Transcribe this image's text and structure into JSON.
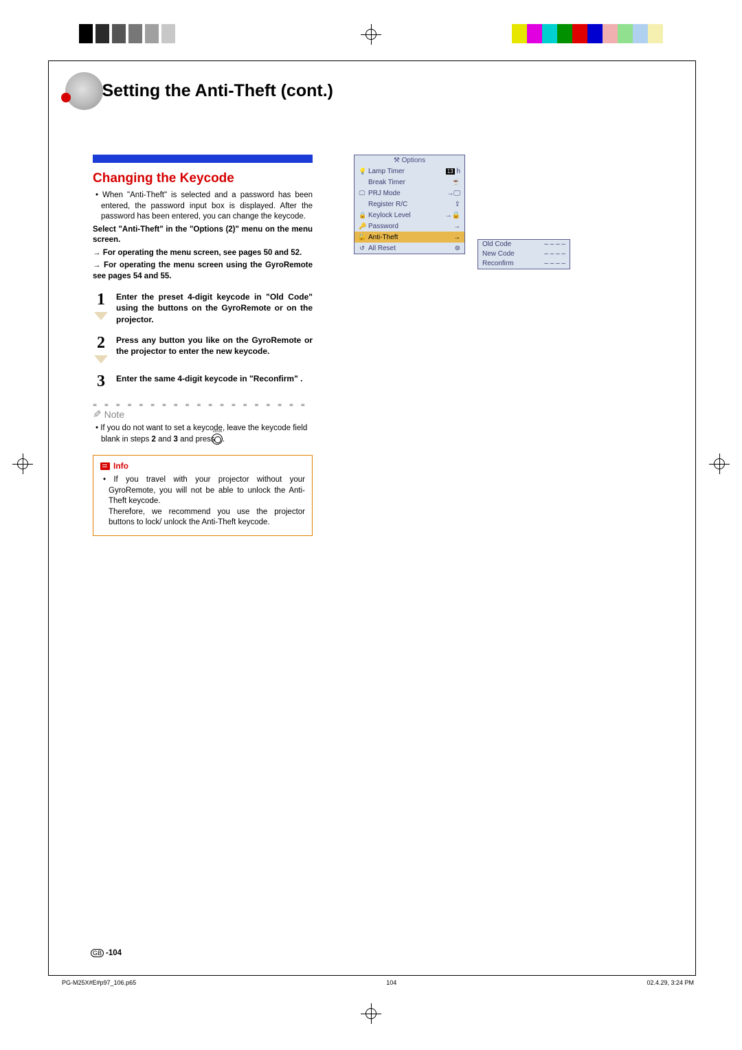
{
  "printer": {
    "bw_levels": [
      "#000",
      "#2b2b2b",
      "#555",
      "#777",
      "#a0a0a0",
      "#c8c8c8"
    ],
    "color_swatches": [
      "#e6e600",
      "#e000e0",
      "#00d0d0",
      "#009000",
      "#e00000",
      "#0000d0",
      "#f0b0b0",
      "#90e090",
      "#b0d0f0",
      "#f5f0b0"
    ]
  },
  "heading": "Setting the Anti-Theft (cont.)",
  "section_title": "Changing the Keycode",
  "intro": "• When \"Anti-Theft\" is selected and  a password has been entered, the password input box is displayed. After the password has been entered, you can change the keycode.",
  "instr1": "Select \"Anti-Theft\" in the \"Options (2)\" menu on the menu screen.",
  "instr2": "→ For operating the menu screen, see pages 50 and 52.",
  "instr3": "→ For operating the menu screen using the GyroRemote see pages 54 and 55.",
  "steps": {
    "s1_num": "1",
    "s1": "Enter the preset 4-digit keycode in \"Old Code\" using the buttons on the GyroRemote or on the projector.",
    "s2_num": "2",
    "s2": "Press any button you like on the GyroRemote or the projector to enter the new keycode.",
    "s3_num": "3",
    "s3": "Enter the same 4-digit keycode in \"Reconfirm\" ."
  },
  "note_label": "Note",
  "note_a": "• If you do not want to set a keycode, leave the keycode field blank in steps ",
  "note_b": "2",
  "note_c": " and ",
  "note_d": "3",
  "note_e": " and press ",
  "note_f": ".",
  "enter_label": "ENTER",
  "info_label": "Info",
  "info_text": "• If you travel with your projector without your GyroRemote, you will not be able to unlock the Anti-Theft keycode.\nTherefore, we recommend you use the projector buttons to lock/ unlock the Anti-Theft keycode.",
  "menu": {
    "title": "Options",
    "rows": [
      {
        "icon": "lamp",
        "label": "Lamp Timer",
        "val_badge": "13",
        "val": "h"
      },
      {
        "icon": "",
        "label": "Break Timer",
        "val": "☕"
      },
      {
        "icon": "screen",
        "label": "PRJ Mode",
        "val": "→🖵"
      },
      {
        "icon": "",
        "label": "Register R/C",
        "val": "⇪"
      },
      {
        "icon": "lock",
        "label": "Keylock Level",
        "val": "→🔒"
      },
      {
        "icon": "key",
        "label": "Password",
        "val": "→"
      },
      {
        "icon": "theft",
        "label": "Anti-Theft",
        "val": "→",
        "hi": true
      },
      {
        "icon": "reset",
        "label": "All Reset",
        "val": "⊚"
      }
    ]
  },
  "codebox": {
    "old_label": "Old Code",
    "new_label": "New Code",
    "re_label": "Reconfirm",
    "blanks": "–  –  –  –"
  },
  "page_num_region": "GB",
  "page_num": "-104",
  "footer": {
    "file": "PG-M25X#E#p97_106.p65",
    "page": "104",
    "date": "02.4.29, 3:24 PM"
  }
}
